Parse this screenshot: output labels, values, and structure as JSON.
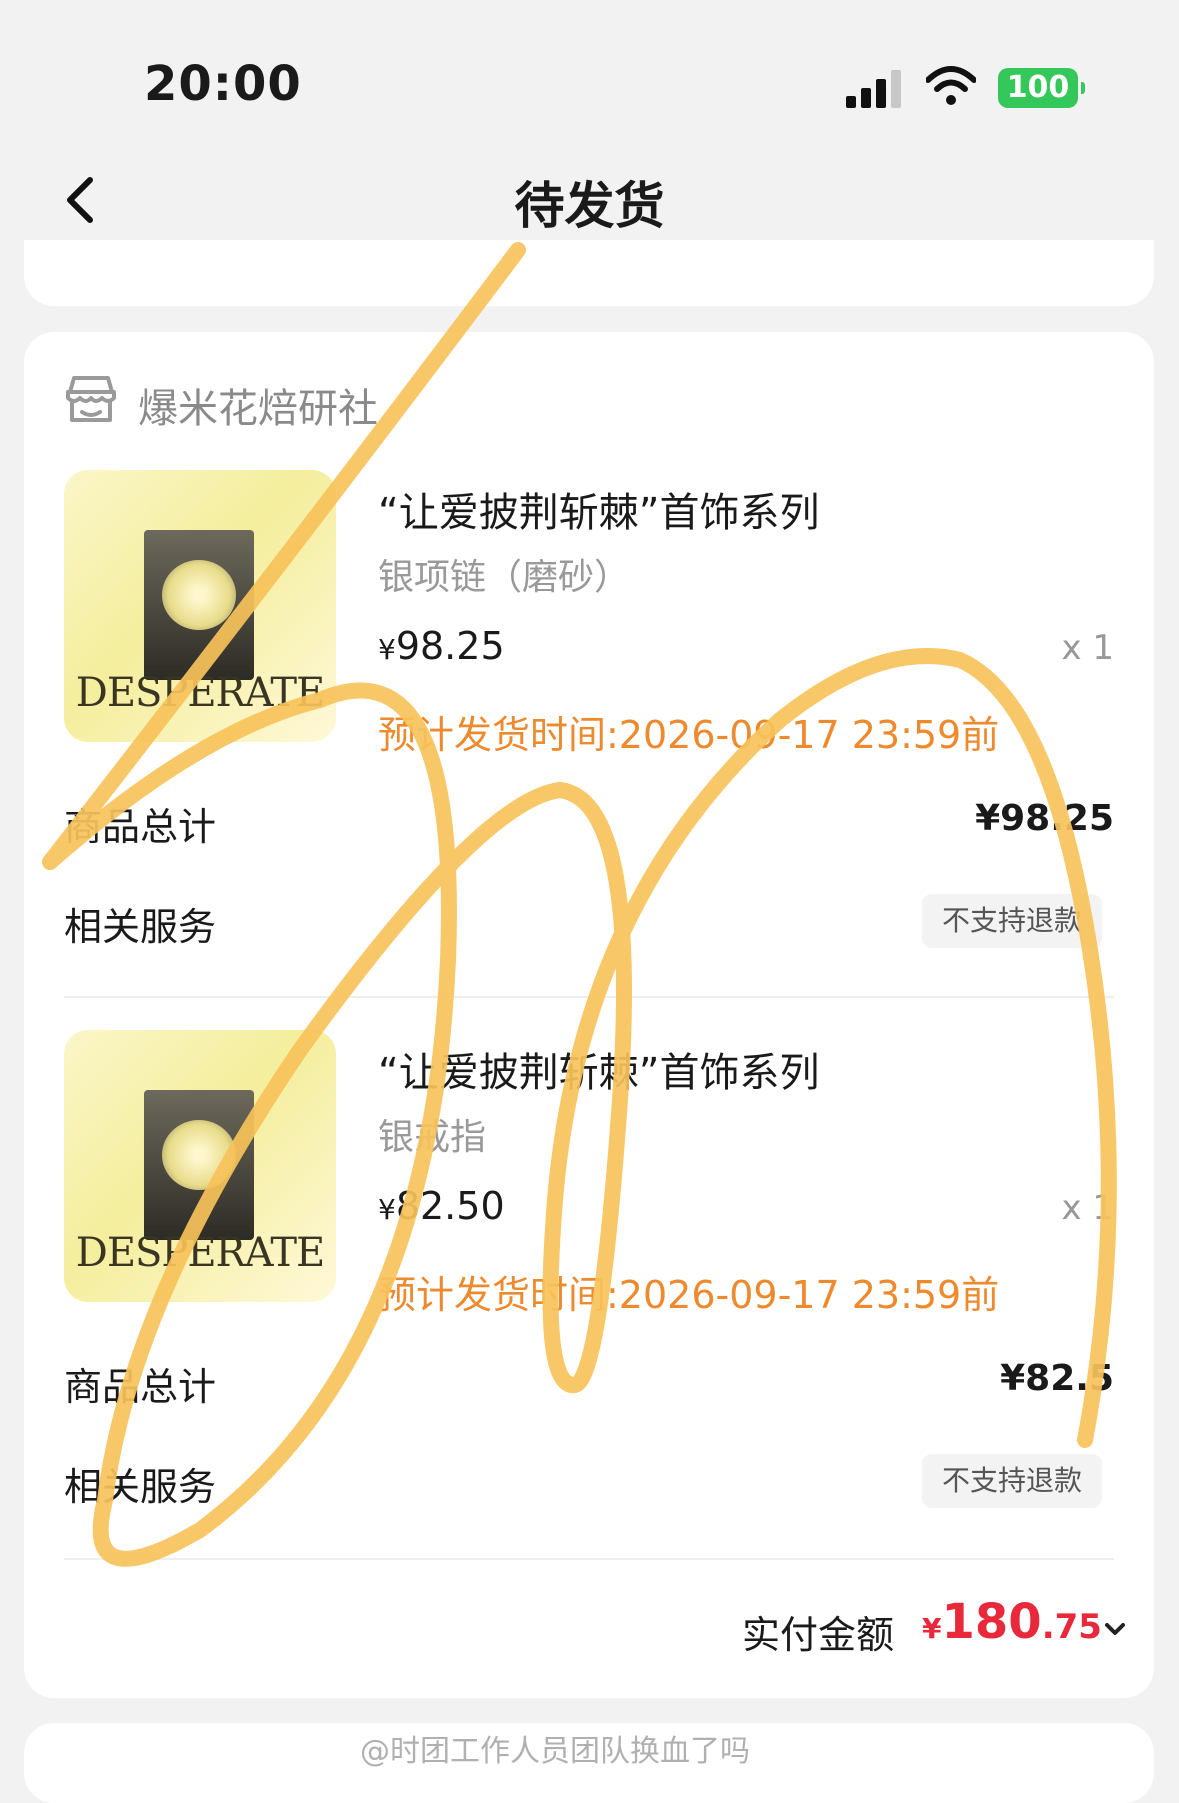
{
  "status_bar": {
    "time": "20:00",
    "battery": "100",
    "icons": [
      "signal-icon",
      "wifi-icon",
      "battery-icon"
    ]
  },
  "nav": {
    "title": "待发货",
    "back_icon": "chevron-left-icon"
  },
  "order": {
    "shop_name": "爆米花焙研社",
    "shop_icon": "store-icon",
    "items": [
      {
        "thumb_text": "DESPERATE",
        "title": "“让爱披荆斩棘”首饰系列",
        "variant": "银项链（磨砂）",
        "price_currency": "¥",
        "price": "98.25",
        "qty": "x 1",
        "ship_time": "预计发货时间:2026-09-17 23:59前",
        "subtotal_label": "商品总计",
        "subtotal": "¥98.25",
        "service_label": "相关服务",
        "service_badge": "不支持退款"
      },
      {
        "thumb_text": "DESPERATE",
        "title": "“让爱披荆斩棘”首饰系列",
        "variant": "银戒指",
        "price_currency": "¥",
        "price": "82.50",
        "qty": "x 1",
        "ship_time": "预计发货时间:2026-09-17 23:59前",
        "subtotal_label": "商品总计",
        "subtotal": "¥82.5",
        "service_label": "相关服务",
        "service_badge": "不支持退款"
      }
    ],
    "total": {
      "label": "实付金额",
      "currency": "¥",
      "integer": "180",
      "decimal": ".75",
      "expand_icon": "chevron-down-icon"
    }
  },
  "watermark": "@时团工作人员团队换血了吗",
  "colors": {
    "ship_time": "#ed8a2e",
    "total_amount": "#e8283b",
    "battery": "#34c759",
    "scribble": "#f7c25a"
  }
}
